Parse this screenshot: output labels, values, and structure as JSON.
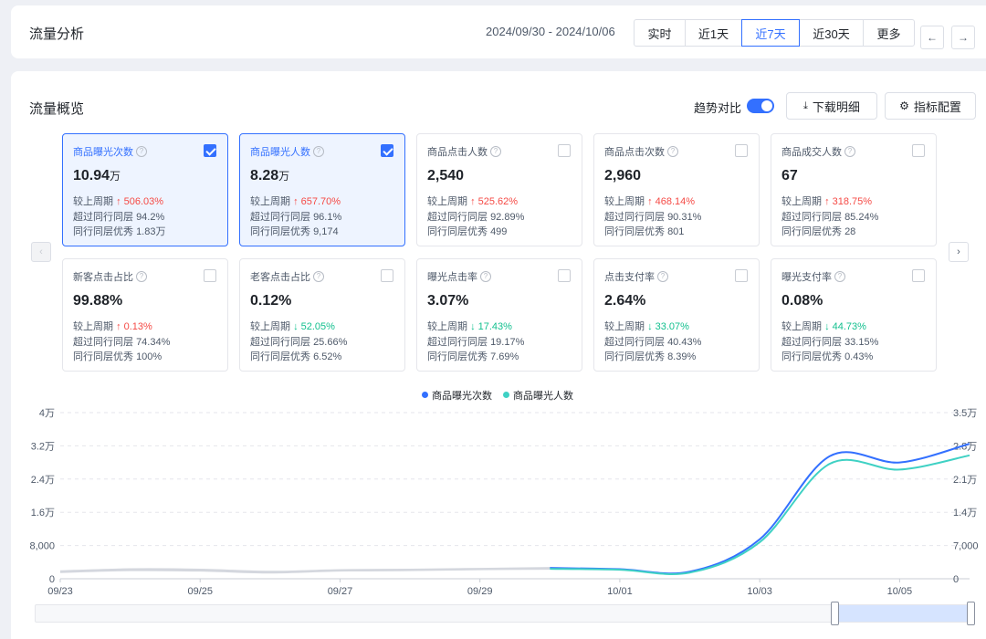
{
  "header": {
    "title": "流量分析",
    "date_range": "2024/09/30 - 2024/10/06",
    "periods": [
      "实时",
      "近1天",
      "近7天",
      "近30天",
      "更多"
    ],
    "active_period": "近7天",
    "prev_label": "←",
    "next_label": "→"
  },
  "overview": {
    "title": "流量概览",
    "trend_label": "趋势对比",
    "trend_on": true,
    "download_label": "下载明细",
    "config_label": "指标配置"
  },
  "labels": {
    "prev": "较上周期",
    "exceed": "超过同行同层",
    "excellent": "同行同层优秀"
  },
  "metrics": [
    {
      "name": "商品曝光次数",
      "value": "10.94",
      "unit": "万",
      "selected": true,
      "change": "506.03%",
      "dir": "up",
      "exceed": "94.2%",
      "excellent": "1.83万"
    },
    {
      "name": "商品曝光人数",
      "value": "8.28",
      "unit": "万",
      "selected": true,
      "change": "657.70%",
      "dir": "up",
      "exceed": "96.1%",
      "excellent": "9,174"
    },
    {
      "name": "商品点击人数",
      "value": "2,540",
      "unit": "",
      "selected": false,
      "change": "525.62%",
      "dir": "up",
      "exceed": "92.89%",
      "excellent": "499"
    },
    {
      "name": "商品点击次数",
      "value": "2,960",
      "unit": "",
      "selected": false,
      "change": "468.14%",
      "dir": "up",
      "exceed": "90.31%",
      "excellent": "801"
    },
    {
      "name": "商品成交人数",
      "value": "67",
      "unit": "",
      "selected": false,
      "change": "318.75%",
      "dir": "up",
      "exceed": "85.24%",
      "excellent": "28"
    },
    {
      "name": "新客点击占比",
      "value": "99.88%",
      "unit": "",
      "selected": false,
      "change": "0.13%",
      "dir": "up",
      "exceed": "74.34%",
      "excellent": "100%"
    },
    {
      "name": "老客点击占比",
      "value": "0.12%",
      "unit": "",
      "selected": false,
      "change": "52.05%",
      "dir": "down",
      "exceed": "25.66%",
      "excellent": "6.52%"
    },
    {
      "name": "曝光点击率",
      "value": "3.07%",
      "unit": "",
      "selected": false,
      "change": "17.43%",
      "dir": "down",
      "exceed": "19.17%",
      "excellent": "7.69%"
    },
    {
      "name": "点击支付率",
      "value": "2.64%",
      "unit": "",
      "selected": false,
      "change": "33.07%",
      "dir": "down",
      "exceed": "40.43%",
      "excellent": "8.39%"
    },
    {
      "name": "曝光支付率",
      "value": "0.08%",
      "unit": "",
      "selected": false,
      "change": "44.73%",
      "dir": "down",
      "exceed": "33.15%",
      "excellent": "0.43%"
    }
  ],
  "chart_data": {
    "type": "line",
    "x": [
      "09/23",
      "09/24",
      "09/25",
      "09/26",
      "09/27",
      "09/28",
      "09/29",
      "09/30",
      "10/01",
      "10/02",
      "10/03",
      "10/04",
      "10/05",
      "10/06"
    ],
    "x_ticks": [
      "09/23",
      "09/25",
      "09/27",
      "09/29",
      "10/01",
      "10/03",
      "10/05"
    ],
    "yleft_ticks": [
      "4万",
      "3.2万",
      "2.4万",
      "1.6万",
      "8,000",
      "0"
    ],
    "yright_ticks": [
      "3.5万",
      "2.8万",
      "2.1万",
      "1.4万",
      "7,000",
      "0"
    ],
    "ylim_left": [
      0,
      40000
    ],
    "ylim_right": [
      0,
      35000
    ],
    "grid": true,
    "legend_position": "top-center",
    "series": [
      {
        "name": "商品曝光次数",
        "axis": "left",
        "color": "#3370ff",
        "values": [
          1800,
          2300,
          2200,
          1700,
          2100,
          2200,
          2400,
          2600,
          2300,
          1700,
          9500,
          29500,
          28000,
          32500
        ]
      },
      {
        "name": "商品曝光人数",
        "axis": "right",
        "color": "#3fd1c4",
        "values": [
          1400,
          1800,
          1700,
          1300,
          1700,
          1800,
          2000,
          2100,
          1900,
          1300,
          7700,
          24200,
          23000,
          26000
        ]
      }
    ],
    "compare_color": "#d4d7de",
    "split_index": 7
  }
}
